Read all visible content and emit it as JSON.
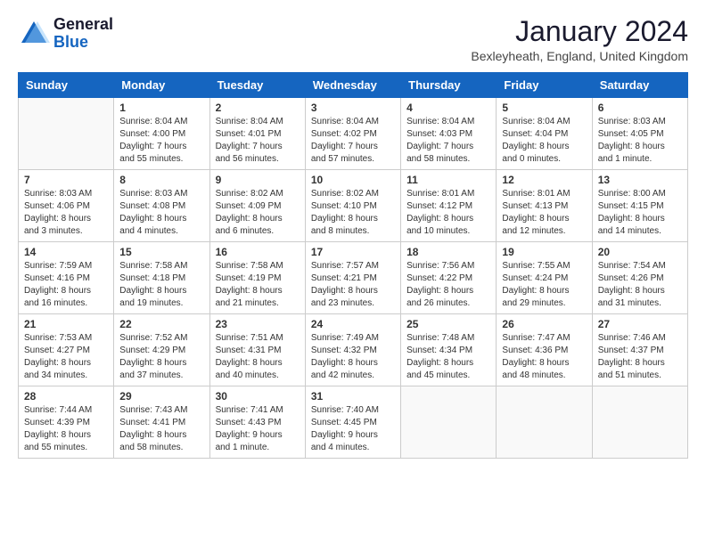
{
  "logo": {
    "line1": "General",
    "line2": "Blue"
  },
  "title": "January 2024",
  "location": "Bexleyheath, England, United Kingdom",
  "days_of_week": [
    "Sunday",
    "Monday",
    "Tuesday",
    "Wednesday",
    "Thursday",
    "Friday",
    "Saturday"
  ],
  "weeks": [
    [
      {
        "day": "",
        "info": ""
      },
      {
        "day": "1",
        "info": "Sunrise: 8:04 AM\nSunset: 4:00 PM\nDaylight: 7 hours\nand 55 minutes."
      },
      {
        "day": "2",
        "info": "Sunrise: 8:04 AM\nSunset: 4:01 PM\nDaylight: 7 hours\nand 56 minutes."
      },
      {
        "day": "3",
        "info": "Sunrise: 8:04 AM\nSunset: 4:02 PM\nDaylight: 7 hours\nand 57 minutes."
      },
      {
        "day": "4",
        "info": "Sunrise: 8:04 AM\nSunset: 4:03 PM\nDaylight: 7 hours\nand 58 minutes."
      },
      {
        "day": "5",
        "info": "Sunrise: 8:04 AM\nSunset: 4:04 PM\nDaylight: 8 hours\nand 0 minutes."
      },
      {
        "day": "6",
        "info": "Sunrise: 8:03 AM\nSunset: 4:05 PM\nDaylight: 8 hours\nand 1 minute."
      }
    ],
    [
      {
        "day": "7",
        "info": "Sunrise: 8:03 AM\nSunset: 4:06 PM\nDaylight: 8 hours\nand 3 minutes."
      },
      {
        "day": "8",
        "info": "Sunrise: 8:03 AM\nSunset: 4:08 PM\nDaylight: 8 hours\nand 4 minutes."
      },
      {
        "day": "9",
        "info": "Sunrise: 8:02 AM\nSunset: 4:09 PM\nDaylight: 8 hours\nand 6 minutes."
      },
      {
        "day": "10",
        "info": "Sunrise: 8:02 AM\nSunset: 4:10 PM\nDaylight: 8 hours\nand 8 minutes."
      },
      {
        "day": "11",
        "info": "Sunrise: 8:01 AM\nSunset: 4:12 PM\nDaylight: 8 hours\nand 10 minutes."
      },
      {
        "day": "12",
        "info": "Sunrise: 8:01 AM\nSunset: 4:13 PM\nDaylight: 8 hours\nand 12 minutes."
      },
      {
        "day": "13",
        "info": "Sunrise: 8:00 AM\nSunset: 4:15 PM\nDaylight: 8 hours\nand 14 minutes."
      }
    ],
    [
      {
        "day": "14",
        "info": "Sunrise: 7:59 AM\nSunset: 4:16 PM\nDaylight: 8 hours\nand 16 minutes."
      },
      {
        "day": "15",
        "info": "Sunrise: 7:58 AM\nSunset: 4:18 PM\nDaylight: 8 hours\nand 19 minutes."
      },
      {
        "day": "16",
        "info": "Sunrise: 7:58 AM\nSunset: 4:19 PM\nDaylight: 8 hours\nand 21 minutes."
      },
      {
        "day": "17",
        "info": "Sunrise: 7:57 AM\nSunset: 4:21 PM\nDaylight: 8 hours\nand 23 minutes."
      },
      {
        "day": "18",
        "info": "Sunrise: 7:56 AM\nSunset: 4:22 PM\nDaylight: 8 hours\nand 26 minutes."
      },
      {
        "day": "19",
        "info": "Sunrise: 7:55 AM\nSunset: 4:24 PM\nDaylight: 8 hours\nand 29 minutes."
      },
      {
        "day": "20",
        "info": "Sunrise: 7:54 AM\nSunset: 4:26 PM\nDaylight: 8 hours\nand 31 minutes."
      }
    ],
    [
      {
        "day": "21",
        "info": "Sunrise: 7:53 AM\nSunset: 4:27 PM\nDaylight: 8 hours\nand 34 minutes."
      },
      {
        "day": "22",
        "info": "Sunrise: 7:52 AM\nSunset: 4:29 PM\nDaylight: 8 hours\nand 37 minutes."
      },
      {
        "day": "23",
        "info": "Sunrise: 7:51 AM\nSunset: 4:31 PM\nDaylight: 8 hours\nand 40 minutes."
      },
      {
        "day": "24",
        "info": "Sunrise: 7:49 AM\nSunset: 4:32 PM\nDaylight: 8 hours\nand 42 minutes."
      },
      {
        "day": "25",
        "info": "Sunrise: 7:48 AM\nSunset: 4:34 PM\nDaylight: 8 hours\nand 45 minutes."
      },
      {
        "day": "26",
        "info": "Sunrise: 7:47 AM\nSunset: 4:36 PM\nDaylight: 8 hours\nand 48 minutes."
      },
      {
        "day": "27",
        "info": "Sunrise: 7:46 AM\nSunset: 4:37 PM\nDaylight: 8 hours\nand 51 minutes."
      }
    ],
    [
      {
        "day": "28",
        "info": "Sunrise: 7:44 AM\nSunset: 4:39 PM\nDaylight: 8 hours\nand 55 minutes."
      },
      {
        "day": "29",
        "info": "Sunrise: 7:43 AM\nSunset: 4:41 PM\nDaylight: 8 hours\nand 58 minutes."
      },
      {
        "day": "30",
        "info": "Sunrise: 7:41 AM\nSunset: 4:43 PM\nDaylight: 9 hours\nand 1 minute."
      },
      {
        "day": "31",
        "info": "Sunrise: 7:40 AM\nSunset: 4:45 PM\nDaylight: 9 hours\nand 4 minutes."
      },
      {
        "day": "",
        "info": ""
      },
      {
        "day": "",
        "info": ""
      },
      {
        "day": "",
        "info": ""
      }
    ]
  ]
}
